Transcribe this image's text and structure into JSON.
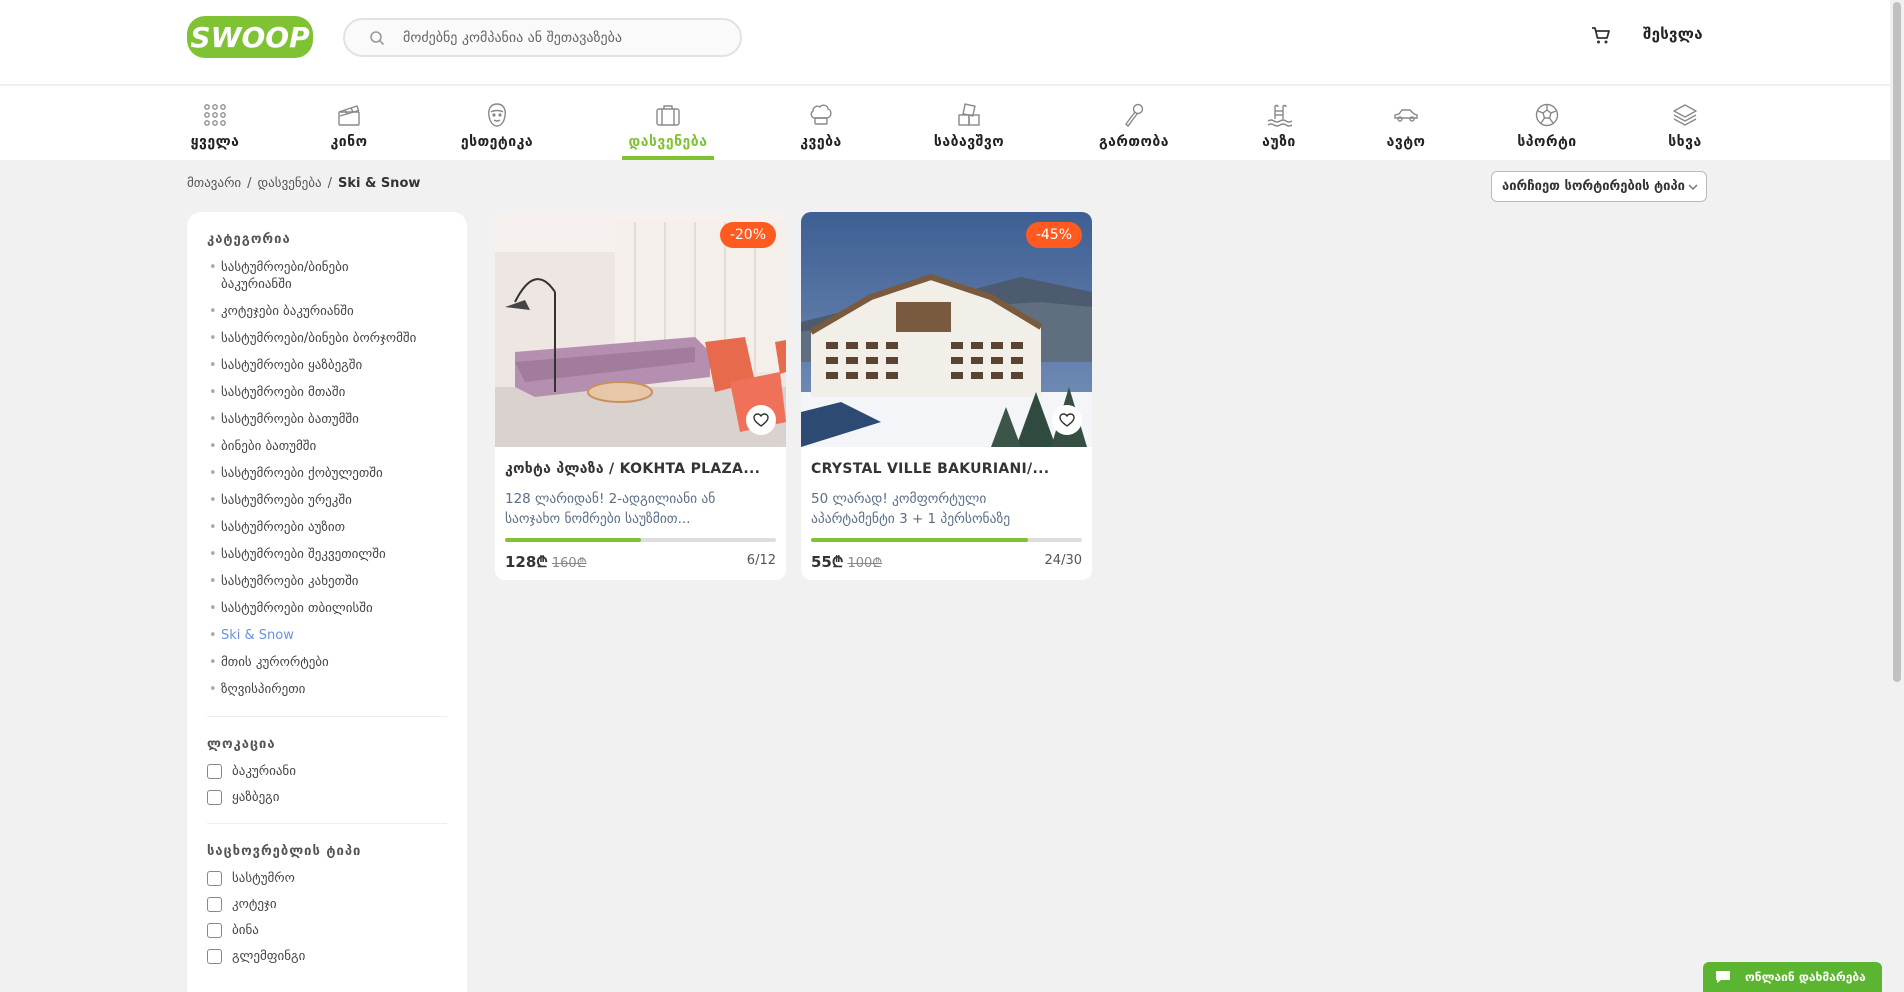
{
  "header": {
    "logo_text": "SWOOP",
    "search_placeholder": "მოძებნე კომპანია ან შეთავაზება",
    "login_label": "შესვლა"
  },
  "categories": [
    {
      "label": "ყველა",
      "icon": "grid-icon"
    },
    {
      "label": "კინო",
      "icon": "clapperboard-icon"
    },
    {
      "label": "ესთეტიკა",
      "icon": "face-icon"
    },
    {
      "label": "დასვენება",
      "icon": "suitcase-icon",
      "active": true
    },
    {
      "label": "კვება",
      "icon": "chef-hat-icon"
    },
    {
      "label": "საბავშვო",
      "icon": "toy-blocks-icon"
    },
    {
      "label": "გართობა",
      "icon": "microphone-icon"
    },
    {
      "label": "აუზი",
      "icon": "pool-icon"
    },
    {
      "label": "ავტო",
      "icon": "car-icon"
    },
    {
      "label": "სპორტი",
      "icon": "ball-icon"
    },
    {
      "label": "სხვა",
      "icon": "layers-icon"
    }
  ],
  "breadcrumb": {
    "home": "მთავარი",
    "sep": "/",
    "parent": "დასვენება",
    "current": "Ski & Snow"
  },
  "sort": {
    "label": "აირჩიეთ სორტირების ტიპი"
  },
  "sidebar": {
    "category_title": "კატეგორია",
    "categories": [
      "სასტუმროები/ბინები ბაკურიანში",
      "კოტეჯები ბაკურიანში",
      "სასტუმროები/ბინები ბორჯომში",
      "სასტუმროები ყაზბეგში",
      "სასტუმროები მთაში",
      "სასტუმროები ბათუმში",
      "ბინები ბათუმში",
      "სასტუმროები ქობულეთში",
      "სასტუმროები ურეკში",
      "სასტუმროები აუზით",
      "სასტუმროები შეკვეთილში",
      "სასტუმროები კახეთში",
      "სასტუმროები თბილისში",
      "Ski & Snow",
      "მთის კურორტები",
      "ზღვისპირეთი"
    ],
    "active_category": "Ski & Snow",
    "location_title": "ლოკაცია",
    "locations": [
      "ბაკურიანი",
      "ყაზბეგი"
    ],
    "type_title": "საცხოვრებლის ტიპი",
    "types": [
      "სასტუმრო",
      "კოტეჯი",
      "ბინა",
      "გლემფინგი"
    ]
  },
  "offers": [
    {
      "discount": "-20%",
      "title": "კოხტა პლაზა / KOKHTA PLAZA...",
      "desc_line1": "128 ლარიდან! 2-ადგილიანი ან",
      "desc_line2": "საოჯახო ნომრები საუზმით...",
      "progress": 0.5,
      "price": "128₾",
      "old_price": "160₾",
      "sold": "6/12"
    },
    {
      "discount": "-45%",
      "title": "CRYSTAL VILLE BAKURIANI/...",
      "desc_line1": "50 ლარად! კომფორტული",
      "desc_line2": "აპარტამენტი 3 + 1 პერსონაზე",
      "progress": 0.8,
      "price": "55₾",
      "old_price": "100₾",
      "sold": "24/30"
    }
  ],
  "chat": {
    "label": "ონლაინ დახმარება"
  },
  "colors": {
    "brand_green": "#7fc233",
    "badge_orange": "#ff5a1f",
    "link_blue": "#6b8fe5"
  }
}
